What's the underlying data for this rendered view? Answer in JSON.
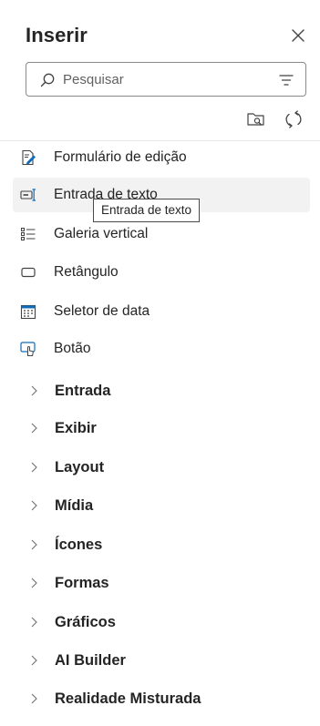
{
  "header": {
    "title": "Inserir",
    "close_icon": "close-icon"
  },
  "search": {
    "placeholder": "Pesquisar",
    "icon": "search-icon",
    "filter_icon": "filter-icon"
  },
  "toolbar": {
    "icons": [
      "folder-search-icon",
      "refresh-icon"
    ]
  },
  "items": [
    {
      "label": "Formulário de edição",
      "icon": "edit-form-icon"
    },
    {
      "label": "Entrada de texto",
      "icon": "text-input-icon"
    },
    {
      "label": "Galeria vertical",
      "icon": "vertical-gallery-icon"
    },
    {
      "label": "Retângulo",
      "icon": "rectangle-icon"
    },
    {
      "label": "Seletor de data",
      "icon": "calendar-icon"
    },
    {
      "label": "Botão",
      "icon": "button-icon"
    }
  ],
  "tooltip": {
    "text": "Entrada de texto"
  },
  "categories": [
    {
      "label": "Entrada"
    },
    {
      "label": "Exibir"
    },
    {
      "label": "Layout"
    },
    {
      "label": "Mídia"
    },
    {
      "label": "Ícones"
    },
    {
      "label": "Formas"
    },
    {
      "label": "Gráficos"
    },
    {
      "label": "AI Builder"
    },
    {
      "label": "Realidade Misturada"
    }
  ],
  "colors": {
    "accent": "#0f6cbd",
    "text": "#242424",
    "hover_bg": "#f2f2f2"
  }
}
